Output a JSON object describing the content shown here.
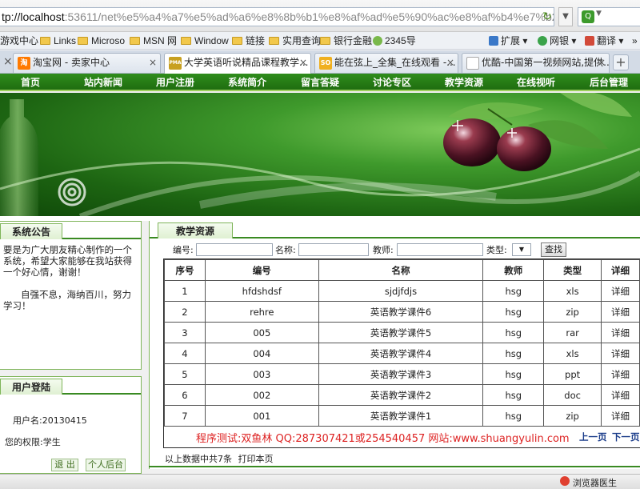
{
  "browser": {
    "address_host": "tp://localhost",
    "address_rest": ":53611/net%e5%a4%a7%e5%ad%a6%e8%8b%b1%e8%af%ad%e5%90%ac%e8%af%b4%e7%b2",
    "favorites": [
      "游戏中心",
      "Links",
      "Microso",
      "MSN 网",
      "Window",
      "链接",
      "实用查询",
      "银行金融",
      "2345导"
    ],
    "toolbar_right": [
      "扩展",
      "网银",
      "翻译"
    ],
    "tabs": [
      {
        "label": "淘宝网 - 卖家中心",
        "icon": "淘"
      },
      {
        "label": "大学英语听说精品课程教学...",
        "icon": "PMA"
      },
      {
        "label": "能在弦上_全集_在线观看 -...",
        "icon": "SO"
      },
      {
        "label": "优酷-中国第一视频网站,提供...",
        "icon": ""
      }
    ],
    "status_right": "浏览器医生"
  },
  "nav": [
    "首页",
    "站内新闻",
    "用户注册",
    "系统简介",
    "留言答疑",
    "讨论专区",
    "教学资源",
    "在线视听",
    "后台管理"
  ],
  "notice": {
    "title": "系统公告",
    "para1": "要是为广大朋友精心制作的一个系统，希望大家能够在我站获得一个好心情，谢谢！",
    "para2": "自强不息，海纳百川，努力学习！"
  },
  "login": {
    "title": "用户登陆",
    "username_label": "用户名:",
    "username": "20130415",
    "role_label": "您的权限:",
    "role": "学生",
    "logout": "退 出",
    "personal": "个人后台"
  },
  "resources": {
    "title": "教学资源",
    "filter": {
      "code_label": "编号:",
      "name_label": "名称:",
      "teacher_label": "教师:",
      "type_label": "类型:",
      "search_button": "查找"
    },
    "columns": [
      "序号",
      "编号",
      "名称",
      "教师",
      "类型",
      "详细"
    ],
    "rows": [
      [
        "1",
        "hfdshdsf",
        "sjdjfdjs",
        "hsg",
        "xls",
        "详细"
      ],
      [
        "2",
        "rehre",
        "英语教学课件6",
        "hsg",
        "zip",
        "详细"
      ],
      [
        "3",
        "005",
        "英语教学课件5",
        "hsg",
        "rar",
        "详细"
      ],
      [
        "4",
        "004",
        "英语教学课件4",
        "hsg",
        "xls",
        "详细"
      ],
      [
        "5",
        "003",
        "英语教学课件3",
        "hsg",
        "ppt",
        "详细"
      ],
      [
        "6",
        "002",
        "英语教学课件2",
        "hsg",
        "doc",
        "详细"
      ],
      [
        "7",
        "001",
        "英语教学课件1",
        "hsg",
        "zip",
        "详细"
      ]
    ],
    "credit": "程序测试:双鱼林 QQ:287307421或254540457 网站:www.shuangyulin.com",
    "prev_page": "上一页",
    "next_page": "下一页",
    "summary": "以上数据中共7条",
    "print": "打印本页"
  }
}
